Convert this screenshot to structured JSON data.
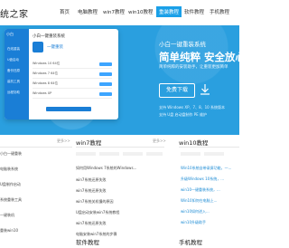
{
  "header": {
    "logo": "统之家",
    "nav": [
      {
        "label": "首页",
        "active": false
      },
      {
        "label": "电脑教程",
        "active": false
      },
      {
        "label": "win7教程",
        "active": false
      },
      {
        "label": "win10教程",
        "active": false
      },
      {
        "label": "重装教程",
        "active": true
      },
      {
        "label": "软件教程",
        "active": false
      },
      {
        "label": "手机教程",
        "active": false
      }
    ]
  },
  "app_window": {
    "brand": "小白",
    "title": "小白一键重装系统",
    "subtitle": "一键重装",
    "sidebar": [
      "在线重装",
      "U盘启动",
      "备份还原",
      "装机工具",
      "远程协助"
    ],
    "os_rows": [
      "Windows 10 64位",
      "Windows 7 64位",
      "Windows 8 64位",
      "Windows XP"
    ],
    "progress_label": "下一步"
  },
  "hero": {
    "line1": "小白一键重装系统",
    "line2": "简单纯粹 安全放心",
    "line3": "简单纯粹的安装助手，让重装更加简单",
    "download_label": "免费下载",
    "support1": "支持 Windows XP、7、8、10 系统版本",
    "support2": "支持 U盘 启动盘制作 PE 维护"
  },
  "columns": [
    {
      "title": "",
      "more": "更多>>",
      "items": [
        "小白一键重装",
        "电脑装系统",
        "U盘制作启动",
        "系统重装工具",
        "一键装机",
        "重装win10"
      ]
    },
    {
      "title": "win7教程",
      "more": "更多>>",
      "items": [
        "如何用Windows 7系统的Windows...",
        "win7系统还原失败",
        "win7系统还原失败",
        "win7系统关机慢的原因",
        "U盘启动安装win7系统教程",
        "win7系统还原失败",
        "电脑安装win7系统的步骤"
      ]
    },
    {
      "title": "win10教程",
      "more": "更多>>",
      "items": [
        "Win10系统自带录屏功能，一...",
        "升级Windows 10系统，...",
        "win10一键重装系统，...",
        "Win10如何在电脑上...",
        "win10如何进入...",
        "win10升级助手",
        "win10系统还..."
      ]
    }
  ],
  "bottom": {
    "software": "软件教程",
    "phone": "手机教程"
  }
}
